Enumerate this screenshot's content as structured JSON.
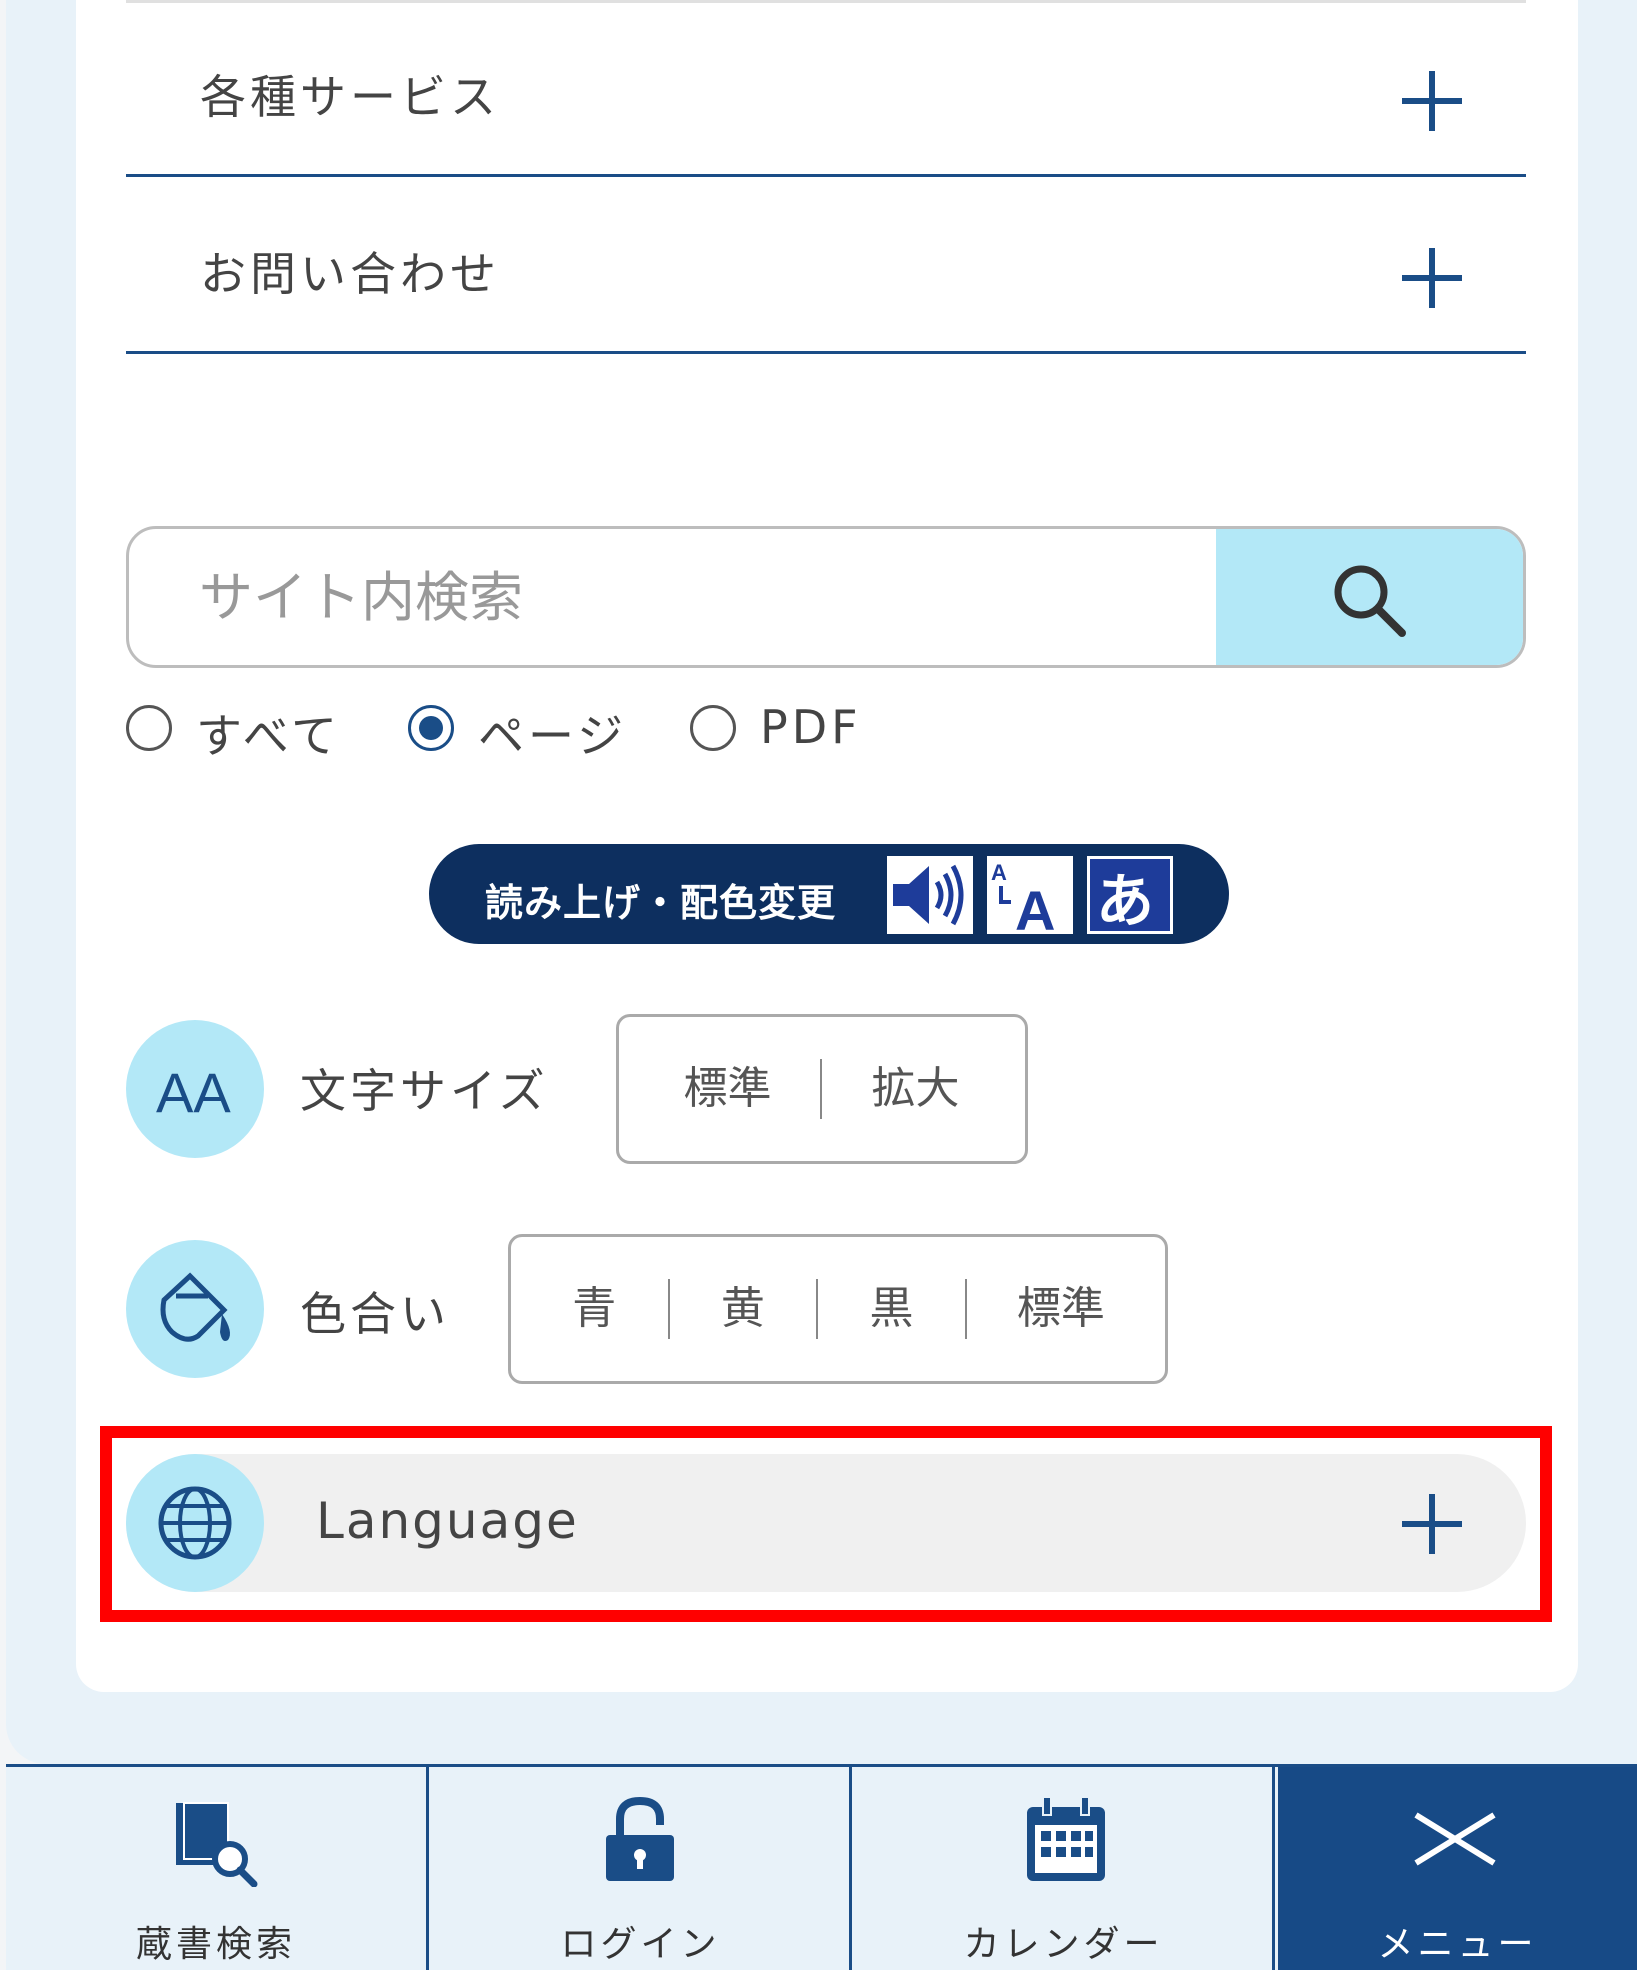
{
  "accordion": [
    {
      "label": "各種サービス"
    },
    {
      "label": "お問い合わせ"
    }
  ],
  "search": {
    "placeholder": "サイト内検索",
    "scopes": [
      {
        "label": "すべて",
        "checked": false
      },
      {
        "label": "ページ",
        "checked": true
      },
      {
        "label": "PDF",
        "checked": false
      }
    ]
  },
  "readspeaker": {
    "label": "読み上げ・配色変更",
    "icon_speaker": "speaker-icon",
    "icon_ruby": "ruby-a-icon",
    "icon_hiragana": "hiragana-a-icon"
  },
  "font_size": {
    "icon_text": "AA",
    "label": "文字サイズ",
    "options": [
      "標準",
      "拡大"
    ]
  },
  "color_scheme": {
    "label": "色合い",
    "options": [
      "青",
      "黄",
      "黒",
      "標準"
    ]
  },
  "language": {
    "label": "Language"
  },
  "bottom_nav": [
    {
      "label": "蔵書検索",
      "icon": "book-search-icon"
    },
    {
      "label": "ログイン",
      "icon": "unlock-icon"
    },
    {
      "label": "カレンダー",
      "icon": "calendar-icon"
    },
    {
      "label": "メニュー",
      "icon": "close-icon",
      "active": true
    }
  ],
  "colors": {
    "accent": "#1a4d87",
    "light_blue": "#b3e8f7",
    "highlight": "#ff0000",
    "nav_active": "#174a86"
  }
}
